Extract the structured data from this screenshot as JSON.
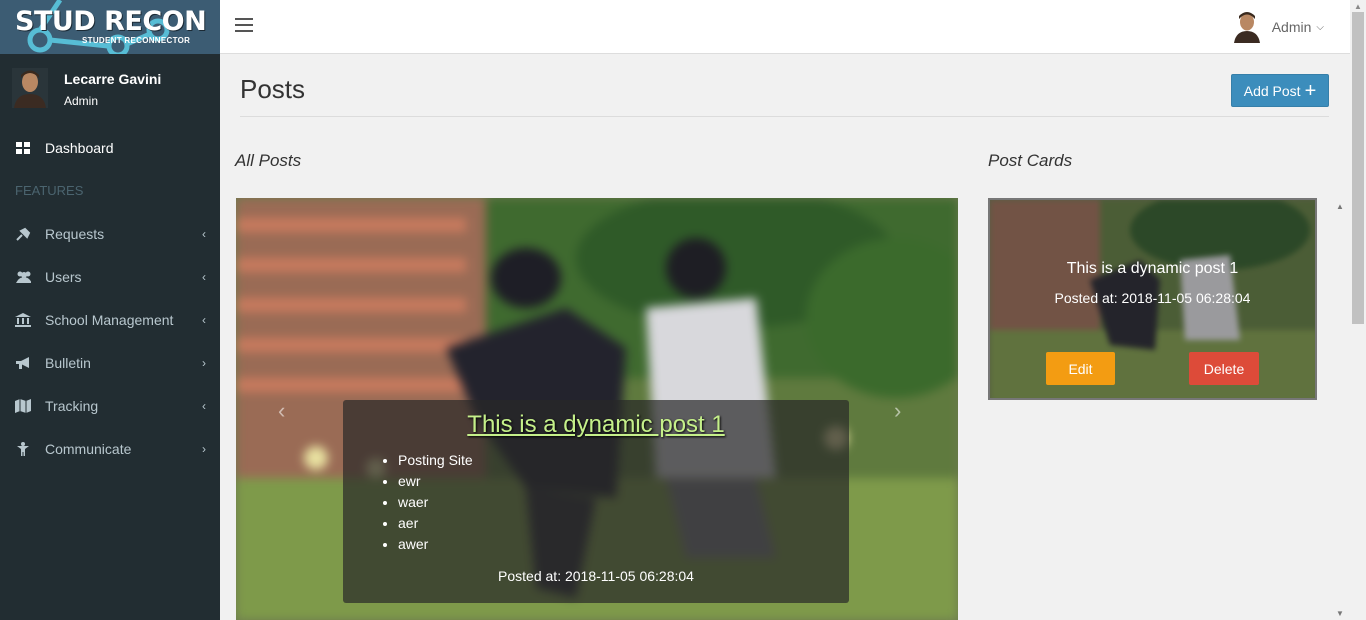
{
  "brand": {
    "name": "STUD RECON",
    "tagline": "STUDENT RECONNECTOR"
  },
  "user_panel": {
    "name": "Lecarre Gavini",
    "role": "Admin"
  },
  "sidebar": {
    "items": [
      {
        "label": "Dashboard",
        "icon": "dashboard-icon"
      },
      {
        "header": "FEATURES"
      },
      {
        "label": "Requests",
        "icon": "plug-icon",
        "chevron": "‹"
      },
      {
        "label": "Users",
        "icon": "users-icon",
        "chevron": "‹"
      },
      {
        "label": "School Management",
        "icon": "bank-icon",
        "chevron": "‹"
      },
      {
        "label": "Bulletin",
        "icon": "bullhorn-icon",
        "chevron": "›"
      },
      {
        "label": "Tracking",
        "icon": "map-icon",
        "chevron": "‹"
      },
      {
        "label": "Communicate",
        "icon": "child-icon",
        "chevron": "›"
      }
    ]
  },
  "topbar": {
    "user_label": "Admin",
    "caret": "⌵"
  },
  "page": {
    "title": "Posts",
    "add_button": "Add Post",
    "add_plus": "+"
  },
  "sections": {
    "all_posts": "All Posts",
    "post_cards": "Post Cards"
  },
  "carousel": {
    "title": "This is a dynamic post 1",
    "items": [
      "Posting Site",
      "ewr",
      "waer",
      "aer",
      "awer"
    ],
    "posted": "Posted at: 2018-11-05 06:28:04",
    "prev": "‹",
    "next": "›"
  },
  "card": {
    "title": "This is a dynamic post 1",
    "posted": "Posted at: 2018-11-05 06:28:04",
    "edit_label": "Edit",
    "delete_label": "Delete"
  },
  "colors": {
    "sidebar_bg": "#222d32",
    "logo_bg": "#3c5c73",
    "primary": "#3c8dbc",
    "warning": "#f39c12",
    "danger": "#dd4b39",
    "caption_title": "#c5f08a"
  }
}
